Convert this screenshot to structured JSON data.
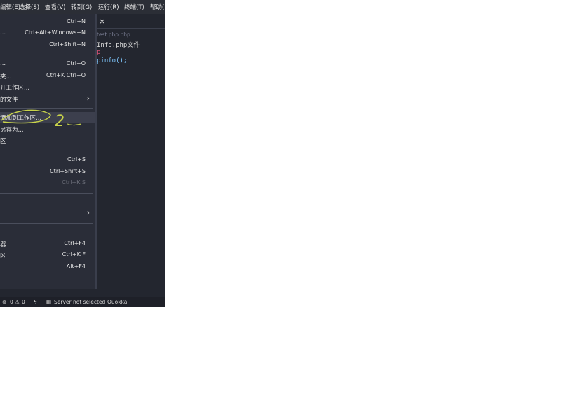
{
  "menubar": {
    "items": [
      "编辑(E)",
      "选择(S)",
      "查看(V)",
      "转到(G)",
      "运行(R)",
      "终端(T)",
      "帮助("
    ]
  },
  "file_menu": {
    "items": [
      {
        "label": "",
        "shortcut": "Ctrl+N"
      },
      {
        "label": "...",
        "shortcut": "Ctrl+Alt+Windows+N"
      },
      {
        "label": "",
        "shortcut": "Ctrl+Shift+N"
      },
      {
        "label": "...",
        "shortcut": "Ctrl+O"
      },
      {
        "label": "夹...",
        "shortcut": "Ctrl+K Ctrl+O"
      },
      {
        "label": "开工作区...",
        "shortcut": ""
      },
      {
        "label": "的文件",
        "shortcut": "",
        "arrow": "›"
      },
      {
        "label": "添加到工作区...",
        "shortcut": ""
      },
      {
        "label": "另存为...",
        "shortcut": ""
      },
      {
        "label": "区",
        "shortcut": ""
      },
      {
        "label": "",
        "shortcut": "Ctrl+S"
      },
      {
        "label": "",
        "shortcut": "Ctrl+Shift+S"
      },
      {
        "label": "",
        "shortcut": "Ctrl+K S"
      },
      {
        "label": "",
        "shortcut": "",
        "arrow": "›"
      },
      {
        "label": "器",
        "shortcut": "Ctrl+F4"
      },
      {
        "label": "区",
        "shortcut": "Ctrl+K F"
      },
      {
        "label": "",
        "shortcut": "Alt+F4"
      }
    ]
  },
  "annotation": {
    "text": "2",
    "color": "#c9d44a"
  },
  "editor": {
    "tab_close": "×",
    "breadcrumb": "test.php.php",
    "lines": [
      "Info.php文件",
      "p",
      "pinfo();"
    ]
  },
  "statusbar": {
    "errors_icon": "⊗",
    "errors": "0",
    "warnings_icon": "⚠",
    "warnings": "0",
    "bolt_icon": "ϟ",
    "server_icon": "▦",
    "server": "Server not selected",
    "quokka": "Quokka"
  },
  "colors": {
    "background": "#23262f",
    "menu": "#2a2d38",
    "highlight": "#3c3f4d"
  }
}
